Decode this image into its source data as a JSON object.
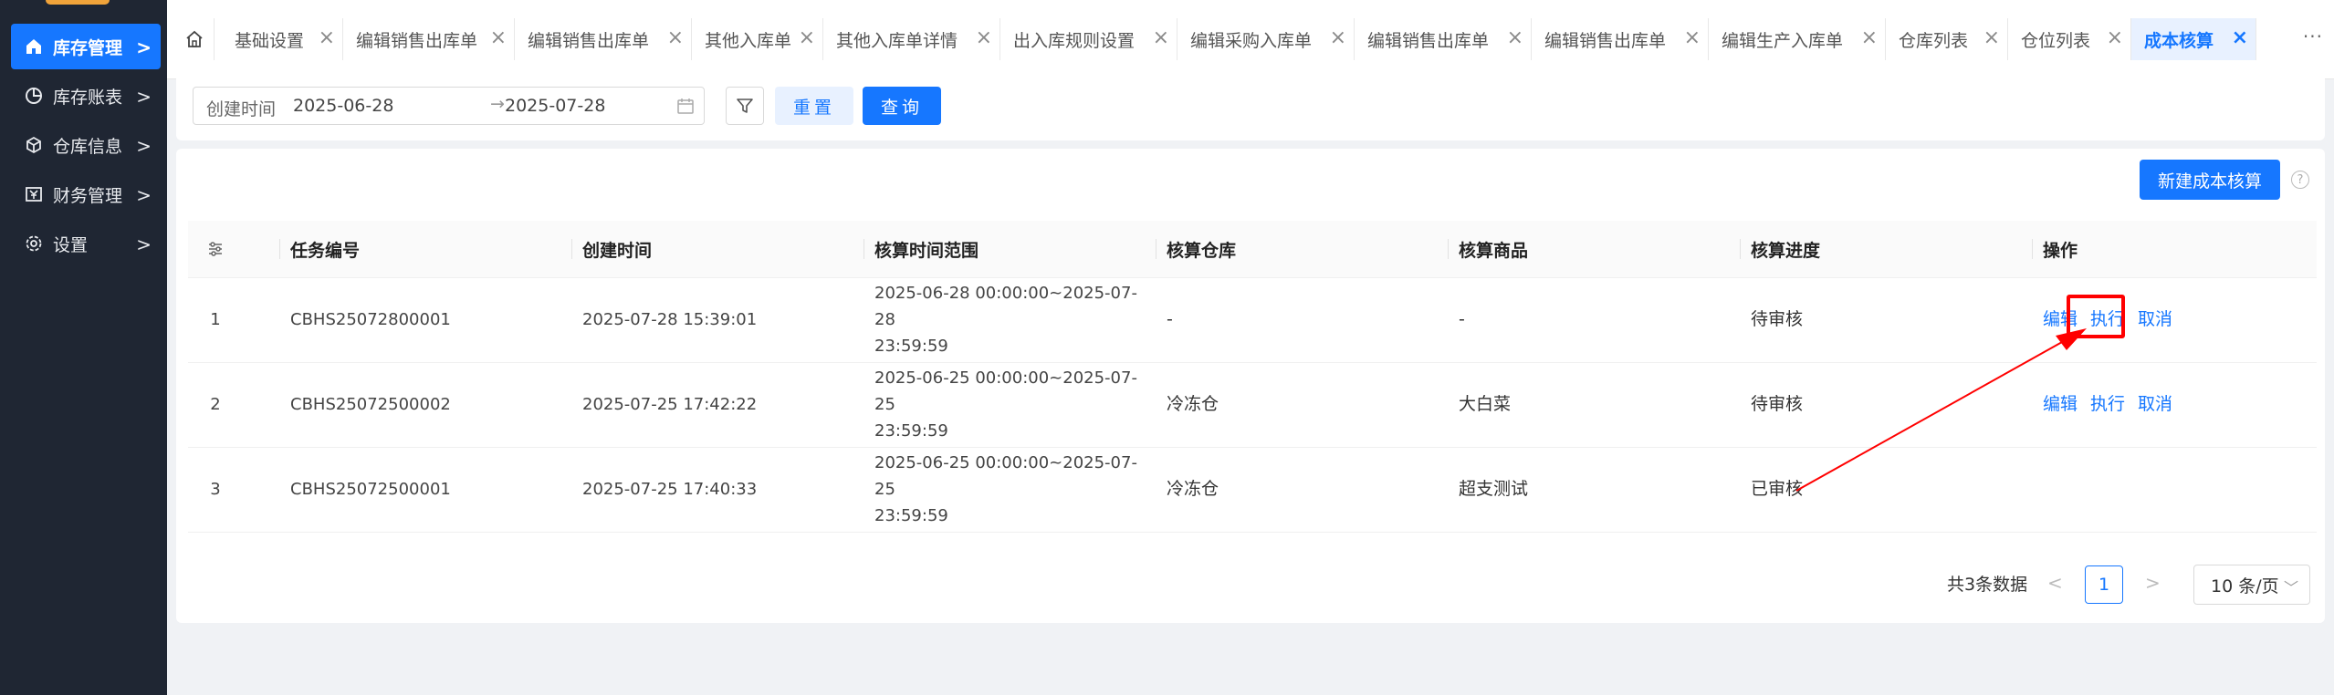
{
  "sidebar": {
    "items": [
      {
        "label": "库存管理",
        "icon": "home-icon",
        "active": true
      },
      {
        "label": "库存账表",
        "icon": "pie-chart-icon"
      },
      {
        "label": "仓库信息",
        "icon": "cube-icon"
      },
      {
        "label": "财务管理",
        "icon": "finance-icon"
      },
      {
        "label": "设置",
        "icon": "gear-icon"
      }
    ]
  },
  "tabs": [
    {
      "label": "基础设置"
    },
    {
      "label": "编辑销售出库单"
    },
    {
      "label": "编辑销售出库单"
    },
    {
      "label": "其他入库单"
    },
    {
      "label": "其他入库单详情"
    },
    {
      "label": "出入库规则设置"
    },
    {
      "label": "编辑采购入库单"
    },
    {
      "label": "编辑销售出库单"
    },
    {
      "label": "编辑销售出库单"
    },
    {
      "label": "编辑生产入库单"
    },
    {
      "label": "仓库列表"
    },
    {
      "label": "仓位列表"
    },
    {
      "label": "成本核算",
      "active": true
    }
  ],
  "filter": {
    "date_label": "创建时间",
    "start_date": "2025-06-28",
    "end_date": "2025-07-28",
    "arrow": "→",
    "reset_label": "重置",
    "query_label": "查询"
  },
  "toolbar": {
    "new_label": "新建成本核算",
    "help": "?"
  },
  "table": {
    "columns": [
      "任务编号",
      "创建时间",
      "核算时间范围",
      "核算仓库",
      "核算商品",
      "核算进度",
      "操作"
    ],
    "rows": [
      {
        "index": "1",
        "task_no": "CBHS25072800001",
        "created": "2025-07-28 15:39:01",
        "range_line1": "2025-06-28 00:00:00~2025-07-28",
        "range_line2": "23:59:59",
        "warehouse": "-",
        "goods": "-",
        "progress": "待审核",
        "actions": [
          "编辑",
          "执行",
          "取消"
        ]
      },
      {
        "index": "2",
        "task_no": "CBHS25072500002",
        "created": "2025-07-25 17:42:22",
        "range_line1": "2025-06-25 00:00:00~2025-07-25",
        "range_line2": "23:59:59",
        "warehouse": "冷冻仓",
        "goods": "大白菜",
        "progress": "待审核",
        "actions": [
          "编辑",
          "执行",
          "取消"
        ]
      },
      {
        "index": "3",
        "task_no": "CBHS25072500001",
        "created": "2025-07-25 17:40:33",
        "range_line1": "2025-06-25 00:00:00~2025-07-25",
        "range_line2": "23:59:59",
        "warehouse": "冷冻仓",
        "goods": "超支测试",
        "progress": "已审核",
        "actions": []
      }
    ]
  },
  "pagination": {
    "total_text": "共3条数据",
    "current_page": "1",
    "page_size": "10 条/页",
    "prev": "<",
    "next": ">"
  },
  "colors": {
    "primary": "#1677ff",
    "sidebar_bg": "#1f2633",
    "annotation_red": "#ff0000"
  }
}
